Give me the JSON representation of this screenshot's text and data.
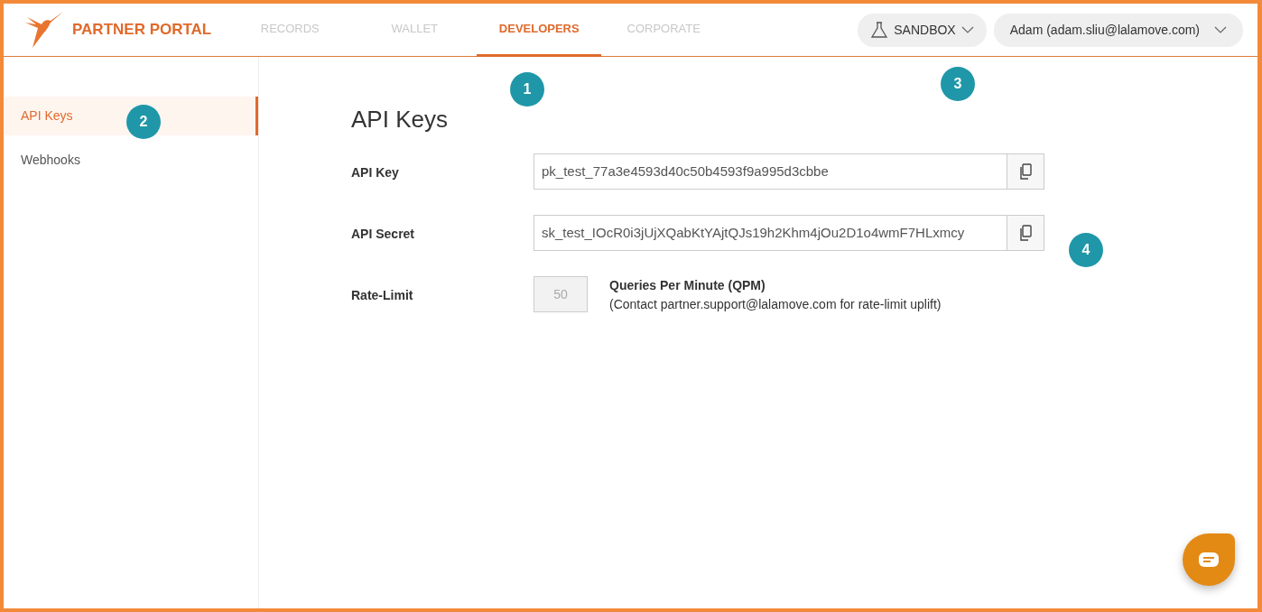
{
  "brand": {
    "name": "PARTNER PORTAL"
  },
  "tabs": [
    {
      "label": "RECORDS",
      "selected": false
    },
    {
      "label": "WALLET",
      "selected": false
    },
    {
      "label": "DEVELOPERS",
      "selected": true
    },
    {
      "label": "CORPORATE",
      "selected": false
    }
  ],
  "environment_menu": {
    "label": "SANDBOX"
  },
  "user_menu": {
    "label": "Adam (adam.sliu@lalamove.com)"
  },
  "sidebar": {
    "items": [
      {
        "label": "API Keys",
        "selected": true
      },
      {
        "label": "Webhooks",
        "selected": false
      }
    ]
  },
  "page_title": "API Keys",
  "fields": [
    {
      "kind": "copy",
      "label": "API Key",
      "value": "pk_test_77a3e4593d40c50b4593f9a995d3cbbe"
    },
    {
      "kind": "copy",
      "label": "API Secret",
      "value": "sk_test_IOcR0i3jUjXQabKtYAjtQJs19h2Khm4jOu2D1o4wmF7HLxmcy"
    },
    {
      "kind": "rate",
      "label": "Rate-Limit",
      "value": "50",
      "unit": "Queries Per Minute (QPM)",
      "note": "(Contact partner.support@lalamove.com for rate-limit uplift)"
    }
  ],
  "callouts": [
    {
      "label": "1"
    },
    {
      "label": "2"
    },
    {
      "label": "3"
    },
    {
      "label": "4"
    }
  ]
}
